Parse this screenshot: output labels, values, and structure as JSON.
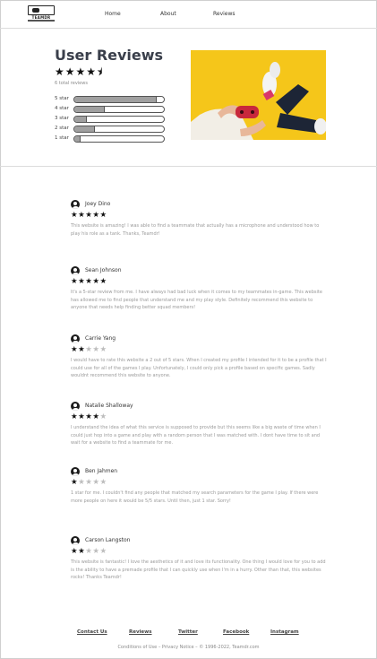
{
  "nav": {
    "logo_text": "TEAMDR",
    "links": [
      "Home",
      "About",
      "Reviews"
    ]
  },
  "hero": {
    "title": "User Reviews",
    "average_rating": 4.5,
    "stars_display": "★★★★⯨",
    "total_reviews": "6 total reviews",
    "breakdown": [
      {
        "label": "5 star",
        "fraction": 0.92
      },
      {
        "label": "4 star",
        "fraction": 0.34
      },
      {
        "label": "3 star",
        "fraction": 0.14
      },
      {
        "label": "2 star",
        "fraction": 0.23
      },
      {
        "label": "1 star",
        "fraction": 0.07
      }
    ]
  },
  "reviews": [
    {
      "name": "Joey Dino",
      "rating": 5,
      "text": "This website is amazing! I was able to find a teammate that actually has a microphone and understood how to play his role as a tank. Thanks, Teamdr!"
    },
    {
      "name": "Sean Johnson",
      "rating": 5,
      "text": "It's a 5-star review from me. I have always had bad luck when it comes to my teammates in-game. This website has allowed me to find people that understand me and my play style. Definitely recommend this website to anyone that needs help finding better squad members!"
    },
    {
      "name": "Carrie Yang",
      "rating": 2,
      "text": "I would have to rate this website a 2 out of 5 stars. When I created my profile I intended for it to be a profile that I could use for all of the games I play. Unfortunately, I could only pick a profile based on specific games. Sadly wouldnt recommend this website to anyone."
    },
    {
      "name": "Natalie Shalloway",
      "rating": 4,
      "text": "I understand the idea of what this service is supposed to provide but this seems like a big waste of time when I could just hop into a game and play with a random person that I was matched with. I dont have time to sit and wait for a website to find a teammate for me."
    },
    {
      "name": "Ben Jahmen",
      "rating": 1,
      "text": "1 star for me. I couldn't find any people that matched my search parameters for the game I play. If there were more people on here it would be 5/5 stars. Until then, just 1 star. Sorry!"
    },
    {
      "name": "Carson Langston",
      "rating": 2,
      "text": "This website is fantastic! I love the aesthetics of it and love its functionality. One thing I would love for you to add is the ability to have a premade profile that I can quickly use when I'm in a hurry. Other than that, this websites rocks! Thanks Teamdr!"
    }
  ],
  "footer": {
    "links": [
      "Contact Us",
      "Reviews",
      "Twitter",
      "Facebook",
      "Instagram"
    ],
    "copyright": "Conditions of Use – Privacy Notice – © 1996-2022, Teamdr.com"
  },
  "colors": {
    "photo_background": "#f5c61a",
    "star_on": "#111111",
    "star_off": "#bdbdbd",
    "bar_fill": "#a0a0a0"
  }
}
